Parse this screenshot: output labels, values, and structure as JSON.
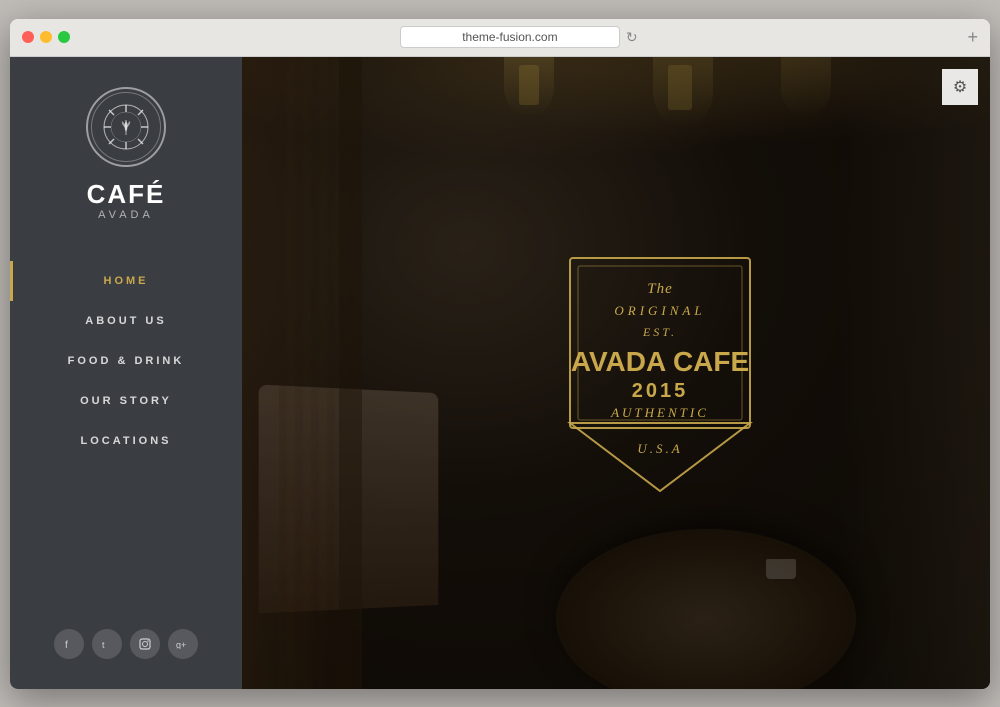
{
  "browser": {
    "url": "theme-fusion.com",
    "new_tab_label": "+"
  },
  "sidebar": {
    "logo": {
      "name": "CAFÉ",
      "subtitle": "AVADA"
    },
    "nav": {
      "items": [
        {
          "id": "home",
          "label": "HOME",
          "active": true
        },
        {
          "id": "about",
          "label": "ABOUT US",
          "active": false
        },
        {
          "id": "food-drink",
          "label": "FOOD & DRINK",
          "active": false
        },
        {
          "id": "our-story",
          "label": "OUR STORY",
          "active": false
        },
        {
          "id": "locations",
          "label": "LOCATIONS",
          "active": false
        }
      ]
    },
    "social": {
      "items": [
        {
          "id": "facebook",
          "icon": "f"
        },
        {
          "id": "twitter",
          "icon": "t"
        },
        {
          "id": "instagram",
          "icon": "i"
        },
        {
          "id": "google-plus",
          "icon": "g"
        }
      ]
    }
  },
  "main": {
    "badge": {
      "line1": "The",
      "line2": "ORIGINAL",
      "line3": "EST.",
      "line4": "AVADA CAFE",
      "year": "2015",
      "line5": "AUTHENTIC",
      "line6": "U.S.A"
    },
    "settings_icon": "⚙"
  },
  "colors": {
    "sidebar_bg": "#3a3d42",
    "active_color": "#c9a84c",
    "badge_color": "#c9a84c",
    "bg_dark": "#1a1208"
  }
}
